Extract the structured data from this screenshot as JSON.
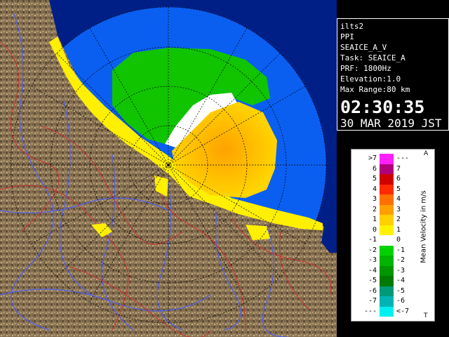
{
  "radar": {
    "site": "ilts2",
    "mode": "PPI",
    "product": "SEAICE_A_V",
    "task": "Task: SEAICE_A",
    "prf": "PRF: 1800Hz",
    "elevation": "Elevation:1.0",
    "max_range": "Max Range:80 km",
    "time": "02:30:35",
    "date": "30 MAR 2019 JST"
  },
  "legend": {
    "title": "Mean Velocity in m/s",
    "top_marker": "A",
    "bottom_marker": "T",
    "rows": [
      {
        "left": ">7",
        "right": "---",
        "color": "#ff20ff"
      },
      {
        "left": "6",
        "right": "7",
        "color": "#b0007a"
      },
      {
        "left": "5",
        "right": "6",
        "color": "#d00000"
      },
      {
        "left": "4",
        "right": "5",
        "color": "#ff2a00"
      },
      {
        "left": "3",
        "right": "4",
        "color": "#ff7000"
      },
      {
        "left": "2",
        "right": "3",
        "color": "#ffa000"
      },
      {
        "left": "1",
        "right": "2",
        "color": "#ffd000"
      },
      {
        "left": "0",
        "right": "1",
        "color": "#fff200"
      },
      {
        "left": "-1",
        "right": "0",
        "color": "#ffffff"
      },
      {
        "left": "-2",
        "right": "-1",
        "color": "#00d200"
      },
      {
        "left": "-3",
        "right": "-2",
        "color": "#00b400"
      },
      {
        "left": "-4",
        "right": "-3",
        "color": "#009600"
      },
      {
        "left": "-5",
        "right": "-4",
        "color": "#007a00"
      },
      {
        "left": "-6",
        "right": "-5",
        "color": "#009a78"
      },
      {
        "left": "-7",
        "right": "-6",
        "color": "#00b4b4"
      },
      {
        "left": "---",
        "right": "<-7",
        "color": "#00f0f0"
      }
    ]
  },
  "colors": {
    "land": "#8b7355",
    "sea_in_range": "#0a5cf0",
    "sea_out_range": "#00208a",
    "coast_echo": "#ffee00"
  }
}
